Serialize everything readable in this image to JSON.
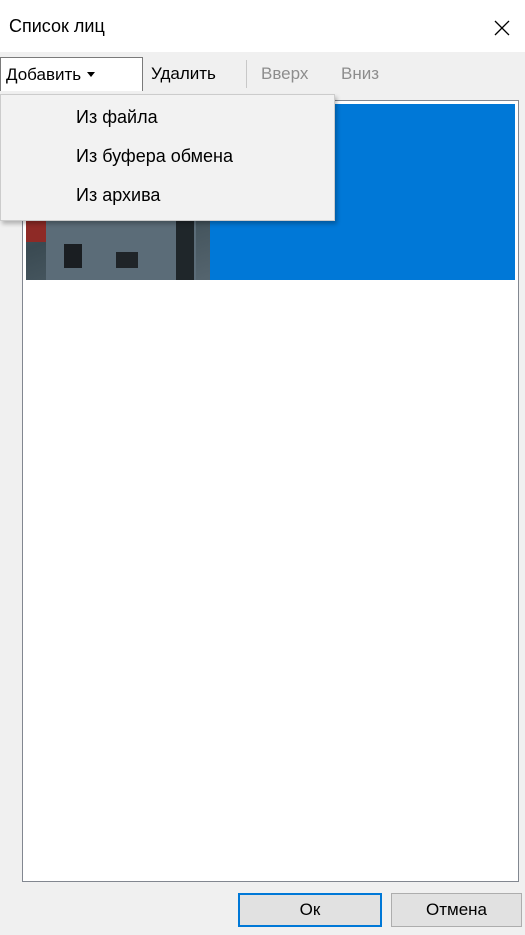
{
  "window": {
    "title": "Список лиц",
    "close_icon": "close-icon"
  },
  "toolbar": {
    "add_label": "Добавить",
    "delete_label": "Удалить",
    "up_label": "Вверх",
    "down_label": "Вниз"
  },
  "add_menu": {
    "items": [
      {
        "label": "Из файла"
      },
      {
        "label": "Из буфера обмена"
      },
      {
        "label": "Из архива"
      }
    ]
  },
  "list": {
    "selected_index": 0,
    "accent_color": "#0078d7"
  },
  "footer": {
    "ok_label": "Ок",
    "cancel_label": "Отмена"
  }
}
